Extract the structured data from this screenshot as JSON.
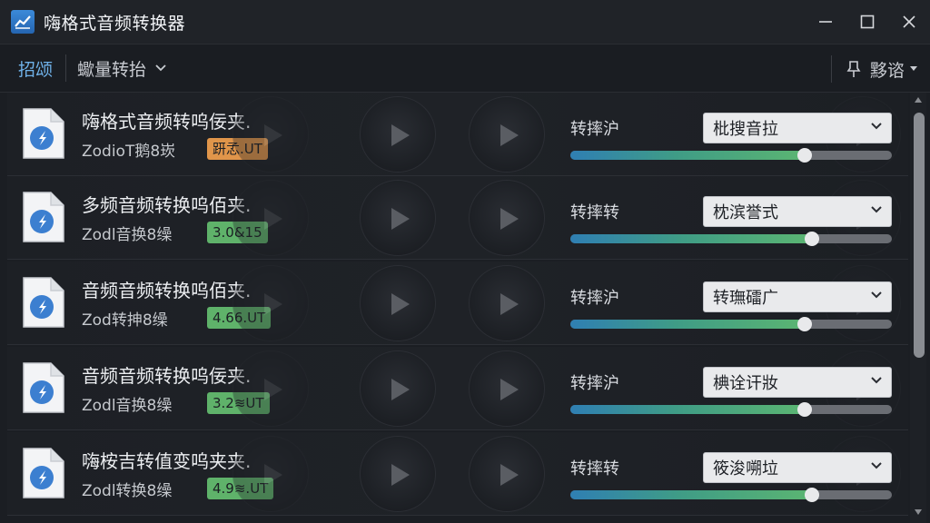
{
  "window": {
    "title": "嗨格式音频转换器"
  },
  "toolbar": {
    "tab_label": "招颂",
    "batch_label": "蠍量转抬",
    "settings_label": "黟谘"
  },
  "rows": [
    {
      "name": "嗨格式音频转呜佞夹.",
      "meta": "ZodioT鹅8崁",
      "badge": "趼孞.UT",
      "badge_color": "#e0954a",
      "conv_label": "转摔沪",
      "select_value": "枇搜音拉",
      "progress": 0.73
    },
    {
      "name": "多频音频转换呜佰夹.",
      "meta": "Zodl音换8缲",
      "badge": "3.0&15",
      "badge_color": "#5fb26a",
      "conv_label": "转摔转",
      "select_value": "枕滨誉式",
      "progress": 0.75
    },
    {
      "name": "音频音频转换呜佰夹.",
      "meta": "Zod转抻8缲",
      "badge": "4.66.UT",
      "badge_color": "#5fb26a",
      "conv_label": "转摔沪",
      "select_value": "转璑礌广",
      "progress": 0.73
    },
    {
      "name": "音频音频转换呜佞夹.",
      "meta": "Zodl音换8缲",
      "badge": "3.2≋UT",
      "badge_color": "#5fb26a",
      "conv_label": "转摔沪",
      "select_value": "椣诠讦妝",
      "progress": 0.73
    },
    {
      "name": "嗨桉吉转值变呜夹夹.",
      "meta": "Zodl转换8缲",
      "badge": "4.9≋.UT",
      "badge_color": "#5fb26a",
      "conv_label": "转摔转",
      "select_value": "筱浚嗍垃",
      "progress": 0.75
    }
  ]
}
